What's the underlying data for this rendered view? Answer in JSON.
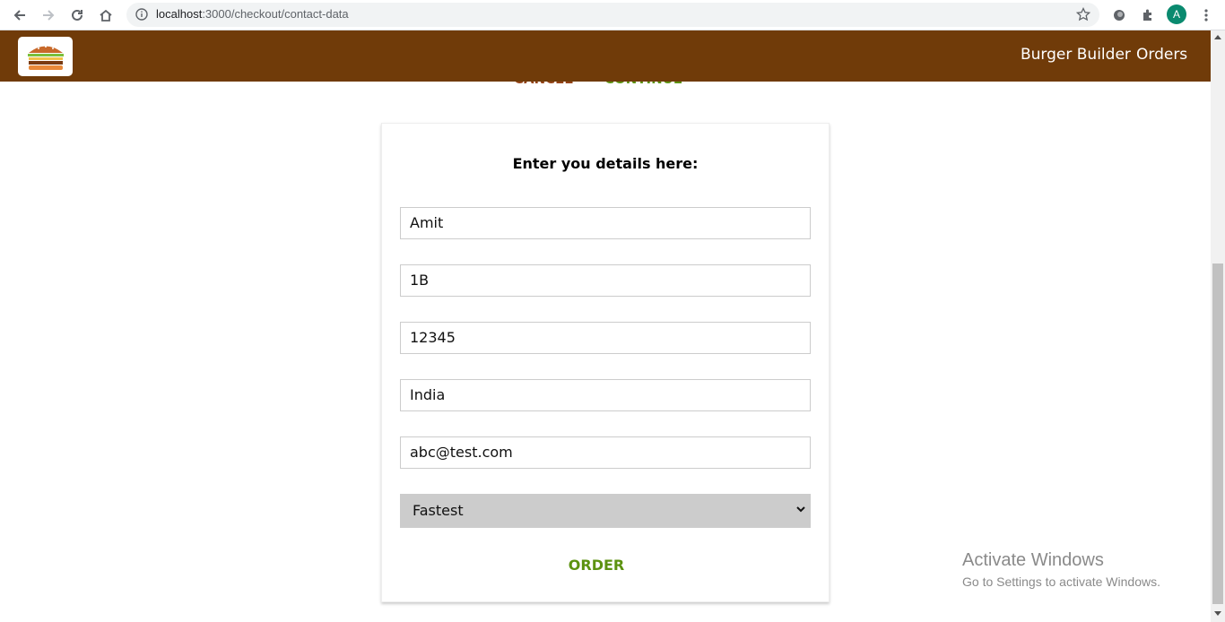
{
  "browser": {
    "url_host": "localhost",
    "url_path": ":3000/checkout/contact-data",
    "avatar_letter": "A"
  },
  "toolbar": {
    "bg_color": "#703b09",
    "nav": [
      {
        "label": "Burger Builder"
      },
      {
        "label": "Orders"
      }
    ],
    "hidden_buttons": [
      {
        "label": "CANCEL"
      },
      {
        "label": "CONTINUE"
      }
    ]
  },
  "form": {
    "title": "Enter you details here:",
    "fields": [
      {
        "value": "Amit"
      },
      {
        "value": "1B"
      },
      {
        "value": "12345"
      },
      {
        "value": "India"
      },
      {
        "value": "abc@test.com"
      }
    ],
    "delivery": {
      "selected": "Fastest"
    },
    "order_label": "ORDER"
  },
  "watermark": {
    "title": "Activate Windows",
    "subtitle": "Go to Settings to activate Windows."
  }
}
